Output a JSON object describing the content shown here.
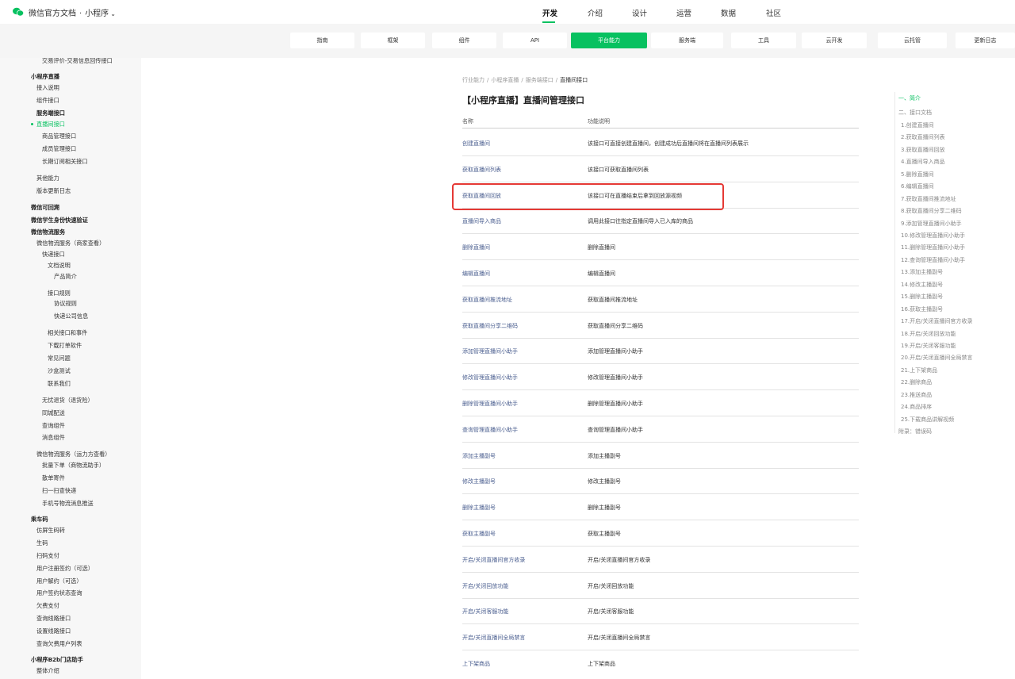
{
  "header": {
    "brand": "微信官方文档",
    "dot": "·",
    "section": "小程序",
    "chevron": "⌄",
    "nav": [
      "开发",
      "介绍",
      "设计",
      "运营",
      "数据",
      "社区"
    ],
    "active_nav": "开发"
  },
  "subnav": {
    "tabs": [
      "指南",
      "框架",
      "组件",
      "API",
      "平台能力",
      "服务端",
      "工具",
      "云开发",
      "云托管",
      "更新日志"
    ],
    "active": "平台能力"
  },
  "sidebar": {
    "items": [
      {
        "label": "交易评价-交易信息回传接口",
        "style": "n"
      },
      {
        "label": "小程序直播",
        "style": "b"
      },
      {
        "label": "接入说明",
        "style": "n"
      },
      {
        "label": "组件接口",
        "style": "n"
      },
      {
        "label": "服务端接口",
        "style": "b"
      },
      {
        "label": "直播间接口",
        "style": "g"
      },
      {
        "label": "商品管理接口",
        "style": "n"
      },
      {
        "label": "成员管理接口",
        "style": "n"
      },
      {
        "label": "长期订阅相关接口",
        "style": "n"
      },
      {
        "label": "其他能力",
        "style": "n"
      },
      {
        "label": "版本更新日志",
        "style": "n"
      },
      {
        "label": "微信可回溯",
        "style": "b"
      },
      {
        "label": "微信学生身份快速验证",
        "style": "b"
      },
      {
        "label": "微信物流服务",
        "style": "b"
      },
      {
        "label": "微信物流服务（商家查看）",
        "style": "n"
      },
      {
        "label": "快递接口",
        "style": "n"
      },
      {
        "label": "文档说明",
        "style": "n"
      },
      {
        "label": "产品简介",
        "style": "n"
      },
      {
        "label": "接口规则",
        "style": "n"
      },
      {
        "label": "协议规则",
        "style": "n"
      },
      {
        "label": "快递公司信息",
        "style": "n"
      },
      {
        "label": "相关接口和事件",
        "style": "n"
      },
      {
        "label": "下载打单软件",
        "style": "n"
      },
      {
        "label": "常见问题",
        "style": "n"
      },
      {
        "label": "沙盒测试",
        "style": "n"
      },
      {
        "label": "联系我们",
        "style": "n"
      },
      {
        "label": "无忧退货（退货险）",
        "style": "n"
      },
      {
        "label": "同城配送",
        "style": "n"
      },
      {
        "label": "查询组件",
        "style": "n"
      },
      {
        "label": "消息组件",
        "style": "n"
      },
      {
        "label": "微信物流服务（运力方查看）",
        "style": "n"
      },
      {
        "label": "批量下单（商物流助手）",
        "style": "n"
      },
      {
        "label": "散单寄件",
        "style": "n"
      },
      {
        "label": "扫一扫查快递",
        "style": "n"
      },
      {
        "label": "手机号物流消息推送",
        "style": "n"
      },
      {
        "label": "乘车码",
        "style": "b"
      },
      {
        "label": "仿屏生码转",
        "style": "n"
      },
      {
        "label": "生码",
        "style": "n"
      },
      {
        "label": "扫码支付",
        "style": "n"
      },
      {
        "label": "用户注册签约（可选）",
        "style": "n"
      },
      {
        "label": "用户解约（可选）",
        "style": "n"
      },
      {
        "label": "用户签约状态查询",
        "style": "n"
      },
      {
        "label": "欠费支付",
        "style": "n"
      },
      {
        "label": "查询线路接口",
        "style": "n"
      },
      {
        "label": "设置线路接口",
        "style": "n"
      },
      {
        "label": "查询欠费用户列表",
        "style": "n"
      },
      {
        "label": "小程序B2b门店助手",
        "style": "b"
      },
      {
        "label": "整体介绍",
        "style": "n"
      }
    ]
  },
  "main": {
    "breadcrumb": [
      "行业能力",
      "小程序直播",
      "服务端接口",
      "直播间接口"
    ],
    "breadcrumb_sep": "/",
    "title": "【小程序直播】直播间管理接口",
    "columns": [
      "名称",
      "功能说明"
    ],
    "rows": [
      {
        "name": "创建直播间",
        "desc": "该接口可直接创建直播间，创建成功后直播间将在直播间列表展示"
      },
      {
        "name": "获取直播间列表",
        "desc": "该接口可获取直播间列表"
      },
      {
        "name": "获取直播间回放",
        "desc": "该接口可在直播结束后拿到回放源视频"
      },
      {
        "name": "直播间导入商品",
        "desc": "调用此接口往指定直播间导入已入库的商品"
      },
      {
        "name": "删除直播间",
        "desc": "删除直播间"
      },
      {
        "name": "编辑直播间",
        "desc": "编辑直播间"
      },
      {
        "name": "获取直播间推流地址",
        "desc": "获取直播间推流地址"
      },
      {
        "name": "获取直播间分享二维码",
        "desc": "获取直播间分享二维码"
      },
      {
        "name": "添加管理直播间小助手",
        "desc": "添加管理直播间小助手"
      },
      {
        "name": "修改管理直播间小助手",
        "desc": "修改管理直播间小助手"
      },
      {
        "name": "删除管理直播间小助手",
        "desc": "删除管理直播间小助手"
      },
      {
        "name": "查询管理直播间小助手",
        "desc": "查询管理直播间小助手"
      },
      {
        "name": "添加主播副号",
        "desc": "添加主播副号"
      },
      {
        "name": "修改主播副号",
        "desc": "修改主播副号"
      },
      {
        "name": "删除主播副号",
        "desc": "删除主播副号"
      },
      {
        "name": "获取主播副号",
        "desc": "获取主播副号"
      },
      {
        "name": "开启/关闭直播间官方收录",
        "desc": "开启/关闭直播间官方收录"
      },
      {
        "name": "开启/关闭回放功能",
        "desc": "开启/关闭回放功能"
      },
      {
        "name": "开启/关闭客服功能",
        "desc": "开启/关闭客服功能"
      },
      {
        "name": "开启/关闭直播间全局禁言",
        "desc": "开启/关闭直播间全局禁言"
      },
      {
        "name": "上下架商品",
        "desc": "上下架商品"
      }
    ]
  },
  "toc": {
    "items": [
      "一、简介",
      "二、接口文档",
      "1.创建直播间",
      "2.获取直播间列表",
      "3.获取直播间回放",
      "4.直播间导入商品",
      "5.删除直播间",
      "6.编辑直播间",
      "7.获取直播间推流地址",
      "8.获取直播间分享二维码",
      "9.添加管理直播间小助手",
      "10.修改管理直播间小助手",
      "11.删除管理直播间小助手",
      "12.查询管理直播间小助手",
      "13.添加主播副号",
      "14.修改主播副号",
      "15.删除主播副号",
      "16.获取主播副号",
      "17.开启/关闭直播间官方收录",
      "18.开启/关闭回放功能",
      "19.开启/关闭客服功能",
      "20.开启/关闭直播间全局禁言",
      "21.上下架商品",
      "22.删除商品",
      "23.推送商品",
      "24.商品排序",
      "25.下载商品讲解视频",
      "附录：错误码"
    ],
    "active": "一、简介"
  },
  "colors": {
    "accent": "#07c160",
    "link": "#4a5e8f",
    "highlight_border": "#e53935"
  },
  "icons": {
    "logo": "wechat-logo-icon",
    "chevron": "chevron-down-icon"
  }
}
